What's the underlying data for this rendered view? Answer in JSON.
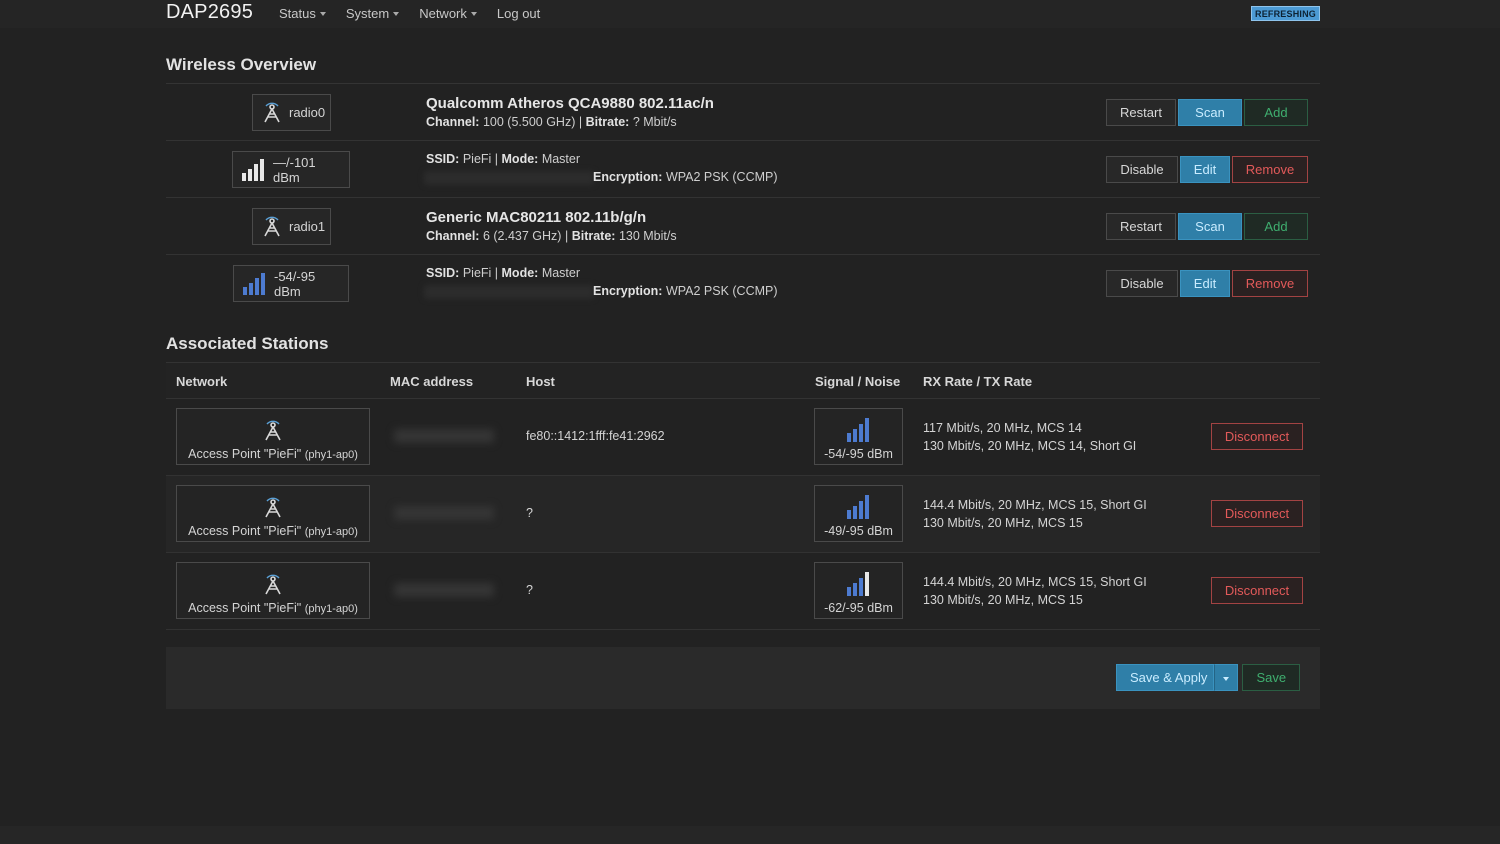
{
  "header": {
    "brand": "DAP2695",
    "nav": [
      {
        "label": "Status",
        "dropdown": true
      },
      {
        "label": "System",
        "dropdown": true
      },
      {
        "label": "Network",
        "dropdown": true
      },
      {
        "label": "Log out",
        "dropdown": false
      }
    ],
    "refresh_badge": "REFRESHING"
  },
  "wireless": {
    "title": "Wireless Overview",
    "rows": [
      {
        "kind": "radio",
        "badge": "radio0",
        "icon": "antenna-icon",
        "title": "Qualcomm Atheros QCA9880 802.11ac/n",
        "channel_label": "Channel:",
        "channel": "100 (5.500 GHz)",
        "bitrate_label": "Bitrate:",
        "bitrate": "? Mbit/s",
        "buttons": [
          "Restart",
          "Scan",
          "Add"
        ]
      },
      {
        "kind": "network",
        "badge": "—/-101 dBm",
        "icon": "signal-bars-icon",
        "ssid_label": "SSID:",
        "ssid": "PieFi",
        "mode_label": "Mode:",
        "mode": "Master",
        "enc_label": "Encryption:",
        "enc": "WPA2 PSK (CCMP)",
        "buttons": [
          "Disable",
          "Edit",
          "Remove"
        ]
      },
      {
        "kind": "radio",
        "badge": "radio1",
        "icon": "antenna-icon",
        "title": "Generic MAC80211 802.11b/g/n",
        "channel_label": "Channel:",
        "channel": "6 (2.437 GHz)",
        "bitrate_label": "Bitrate:",
        "bitrate": "130 Mbit/s",
        "buttons": [
          "Restart",
          "Scan",
          "Add"
        ]
      },
      {
        "kind": "network",
        "badge": "-54/-95 dBm",
        "icon": "signal-bars-icon",
        "ssid_label": "SSID:",
        "ssid": "PieFi",
        "mode_label": "Mode:",
        "mode": "Master",
        "enc_label": "Encryption:",
        "enc": "WPA2 PSK (CCMP)",
        "buttons": [
          "Disable",
          "Edit",
          "Remove"
        ]
      }
    ]
  },
  "stations": {
    "title": "Associated Stations",
    "columns": [
      "Network",
      "MAC address",
      "Host",
      "Signal / Noise",
      "RX Rate / TX Rate"
    ],
    "rows": [
      {
        "network": "Access Point \"PieFi\"",
        "iface": "(phy1-ap0)",
        "host": "fe80::1412:1fff:fe41:2962",
        "signal": "-54/-95 dBm",
        "rx": "117 Mbit/s, 20 MHz, MCS 14",
        "tx": "130 Mbit/s, 20 MHz, MCS 14, Short GI",
        "action": "Disconnect"
      },
      {
        "network": "Access Point \"PieFi\"",
        "iface": "(phy1-ap0)",
        "host": "?",
        "signal": "-49/-95 dBm",
        "rx": "144.4 Mbit/s, 20 MHz, MCS 15, Short GI",
        "tx": "130 Mbit/s, 20 MHz, MCS 15",
        "action": "Disconnect"
      },
      {
        "network": "Access Point \"PieFi\"",
        "iface": "(phy1-ap0)",
        "host": "?",
        "signal": "-62/-95 dBm",
        "rx": "144.4 Mbit/s, 20 MHz, MCS 15, Short GI",
        "tx": "130 Mbit/s, 20 MHz, MCS 15",
        "action": "Disconnect"
      }
    ]
  },
  "footer": {
    "save_apply": "Save & Apply",
    "save": "Save"
  }
}
